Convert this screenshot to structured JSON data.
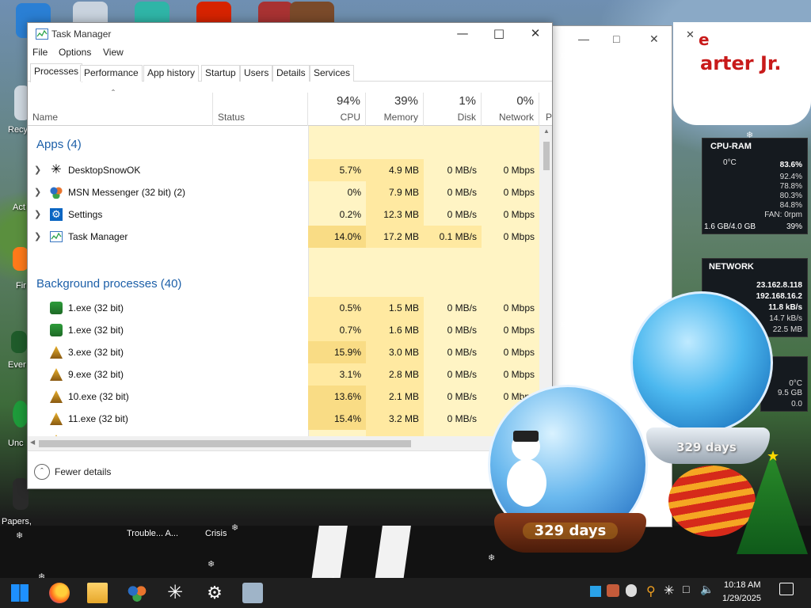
{
  "task_manager": {
    "title": "Task Manager",
    "menu": [
      "File",
      "Options",
      "View"
    ],
    "tabs": [
      "Processes",
      "Performance",
      "App history",
      "Startup",
      "Users",
      "Details",
      "Services"
    ],
    "active_tab": "Processes",
    "columns": {
      "name": "Name",
      "status": "Status",
      "cpu": {
        "pct": "94%",
        "label": "CPU"
      },
      "memory": {
        "pct": "39%",
        "label": "Memory"
      },
      "disk": {
        "pct": "1%",
        "label": "Disk"
      },
      "network": {
        "pct": "0%",
        "label": "Network"
      },
      "power_partial": "P"
    },
    "groups": {
      "apps": "Apps (4)",
      "background": "Background processes (40)"
    },
    "apps": [
      {
        "name": "DesktopSnowOK",
        "cpu": "5.7%",
        "memory": "4.9 MB",
        "disk": "0 MB/s",
        "network": "0 Mbps"
      },
      {
        "name": "MSN Messenger (32 bit) (2)",
        "cpu": "0%",
        "memory": "7.9 MB",
        "disk": "0 MB/s",
        "network": "0 Mbps"
      },
      {
        "name": "Settings",
        "cpu": "0.2%",
        "memory": "12.3 MB",
        "disk": "0 MB/s",
        "network": "0 Mbps"
      },
      {
        "name": "Task Manager",
        "cpu": "14.0%",
        "memory": "17.2 MB",
        "disk": "0.1 MB/s",
        "network": "0 Mbps"
      }
    ],
    "background": [
      {
        "name": "1.exe (32 bit)",
        "cpu": "0.5%",
        "memory": "1.5 MB",
        "disk": "0 MB/s",
        "network": "0 Mbps"
      },
      {
        "name": "1.exe (32 bit)",
        "cpu": "0.7%",
        "memory": "1.6 MB",
        "disk": "0 MB/s",
        "network": "0 Mbps"
      },
      {
        "name": "3.exe (32 bit)",
        "cpu": "15.9%",
        "memory": "3.0 MB",
        "disk": "0 MB/s",
        "network": "0 Mbps"
      },
      {
        "name": "9.exe (32 bit)",
        "cpu": "3.1%",
        "memory": "2.8 MB",
        "disk": "0 MB/s",
        "network": "0 Mbps"
      },
      {
        "name": "10.exe (32 bit)",
        "cpu": "13.6%",
        "memory": "2.1 MB",
        "disk": "0 MB/s",
        "network": "0 Mbps"
      },
      {
        "name": "11.exe (32 bit)",
        "cpu": "15.4%",
        "memory": "3.2 MB",
        "disk": "0 MB/s",
        "network": "0 Mb"
      },
      {
        "name": "11.exe (32 bit)",
        "cpu": "0%",
        "memory": "2.8 MB",
        "disk": "0 MB/s",
        "network": "0 M"
      }
    ],
    "footer": {
      "fewer_details": "Fewer details"
    }
  },
  "banner": {
    "line1": "e",
    "line2": "arter Jr."
  },
  "gadgets": {
    "cpu_ram": {
      "title": "CPU-RAM",
      "temp": "0°C",
      "total": "83.6%",
      "cores": [
        "92.4%",
        "78.8%",
        "80.3%",
        "84.8%"
      ],
      "fan": "FAN: 0rpm",
      "ram": "1.6 GB/4.0 GB",
      "ram_pct": "39%"
    },
    "network": {
      "title": "NETWORK",
      "ext_ip": "23.162.8.118",
      "int_ip": "192.168.16.2",
      "up": "11.8 kB/s",
      "down": "14.7 kB/s",
      "total": "22.5 MB"
    },
    "hdd": {
      "temp": "0°C",
      "size": "9.5 GB",
      "misc": "0.0"
    }
  },
  "snow_globes": {
    "days_left": "329 days",
    "days_right": "329 days"
  },
  "desktop": {
    "labels": [
      "Recy",
      "Act",
      "Fir",
      "Ever",
      "Unc",
      "Papers,",
      "Trouble... A...",
      "Crisis"
    ]
  },
  "taskbar": {
    "time": "10:18 AM",
    "date": "1/29/2025",
    "colors": {
      "bar": "#1f1f1f",
      "accent": "#0078d7"
    }
  },
  "colors": {
    "cpu_heat_light": "#fff4c4",
    "cpu_heat_mid": "#ffe9a1",
    "cpu_heat_strong": "#f9dc85",
    "group_blue": "#1c5fa8"
  }
}
